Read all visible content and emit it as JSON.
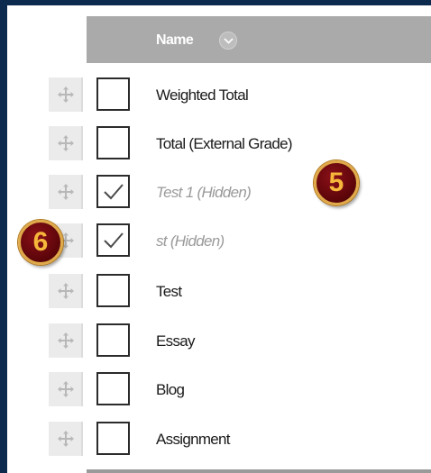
{
  "grid": {
    "column_header": "Name",
    "sort_icon": "chevron-down-icon",
    "drag_icon": "move-arrows-icon",
    "rows": [
      {
        "label": "Weighted Total",
        "checked": false,
        "hidden": false
      },
      {
        "label": "Total (External Grade)",
        "checked": false,
        "hidden": false
      },
      {
        "label": "Test 1 (Hidden)",
        "checked": true,
        "hidden": true
      },
      {
        "label": "st (Hidden)",
        "checked": true,
        "hidden": true
      },
      {
        "label": "Test",
        "checked": false,
        "hidden": false
      },
      {
        "label": "Essay",
        "checked": false,
        "hidden": false
      },
      {
        "label": "Blog",
        "checked": false,
        "hidden": false
      },
      {
        "label": "Assignment",
        "checked": false,
        "hidden": false
      }
    ]
  },
  "callouts": {
    "five": "5",
    "six": "6"
  },
  "colors": {
    "header_bg": "#aaaaaa",
    "callout_fill": "#6b0a10",
    "callout_text": "#f6b73a",
    "frame_border": "#0c2a4e"
  }
}
